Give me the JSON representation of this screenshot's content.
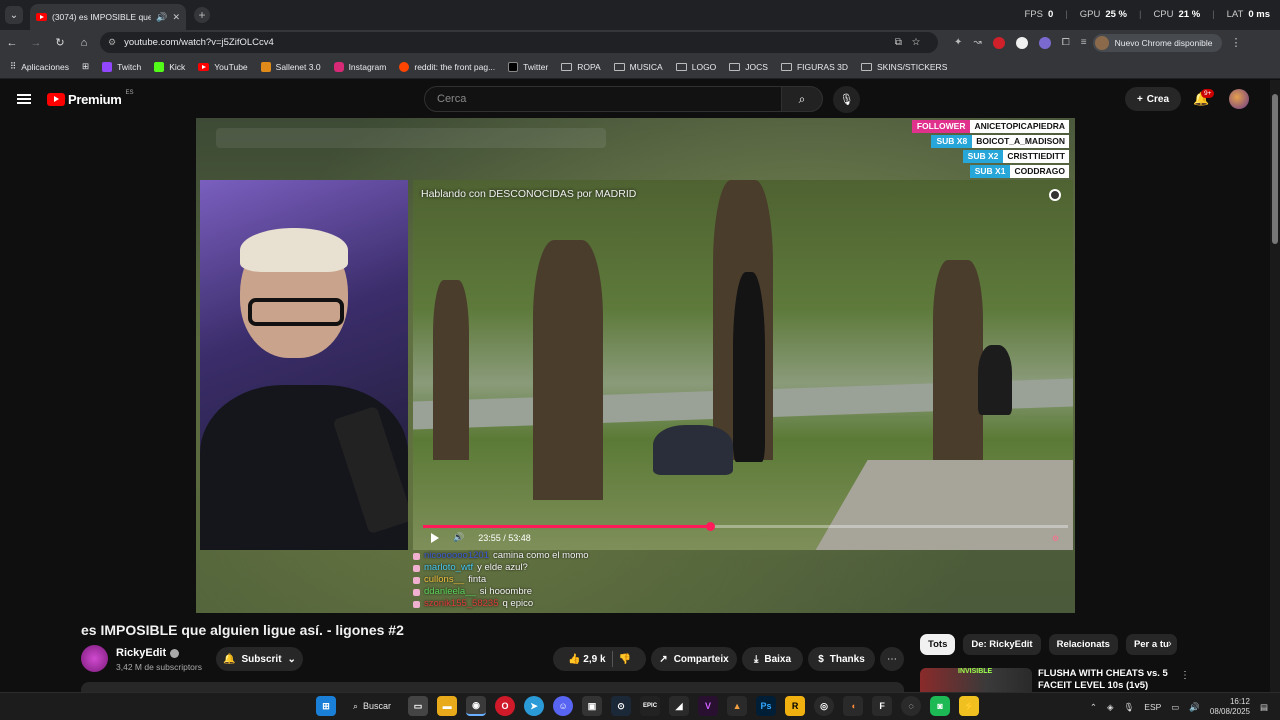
{
  "browser": {
    "tab_title": "(3074) es IMPOSIBLE que a",
    "url": "youtube.com/watch?v=j5ZifOLCcv4",
    "chrome_update_label": "Nuevo Chrome disponible",
    "perf": [
      {
        "label": "FPS",
        "value": "0"
      },
      {
        "label": "GPU",
        "value": "25 %"
      },
      {
        "label": "CPU",
        "value": "21 %"
      },
      {
        "label": "LAT",
        "value": "0 ms"
      }
    ]
  },
  "bookmarks": [
    "Aplicaciones",
    "Twitch",
    "Kick",
    "YouTube",
    "Sallenet 3.0",
    "Instagram",
    "reddit: the front pag...",
    "Twitter",
    "ROPA",
    "MUSICA",
    "LOGO",
    "JOCS",
    "FIGURAS 3D",
    "SKINS/STICKERS"
  ],
  "youtube_header": {
    "logo_text": "Premium",
    "logo_region": "ES",
    "search_placeholder": "Cerca",
    "create_label": "Crea",
    "notifications_badge": "9+"
  },
  "video": {
    "scene_title": "Hablando con DESCONOCIDAS por MADRID",
    "time": "23:55 / 53:48",
    "progress": 0.445,
    "alerts": [
      {
        "tag": "FOLLOWER",
        "name": "ANICETOPICAPIEDRA",
        "color": "#e0328c"
      },
      {
        "tag": "SUB X8",
        "name": "BOICOT_A_MADISON",
        "color": "#27a6d9"
      },
      {
        "tag": "SUB X2",
        "name": "CRISTTIEDITT",
        "color": "#27a6d9"
      },
      {
        "tag": "SUB X1",
        "name": "CODDRAGO",
        "color": "#27a6d9"
      }
    ],
    "chat": [
      {
        "user": "nicoooooo1201",
        "msg": "camina como el momo",
        "color": "#3b5bd6"
      },
      {
        "user": "marloto_wtf",
        "msg": "y elde azul?",
        "color": "#45c8f0"
      },
      {
        "user": "cullons__",
        "msg": "finta",
        "color": "#f0c040"
      },
      {
        "user": "ddanleela__",
        "msg": "si hooombre",
        "color": "#5cd65c"
      },
      {
        "user": "szonik155_58235",
        "msg": "q epico",
        "color": "#e03c3c"
      }
    ]
  },
  "watch": {
    "title": "es IMPOSIBLE que alguien ligue así. - ligones #2",
    "channel": "RickyEdit",
    "subscribers": "3,42 M de subscriptors",
    "subscribe_label": "Subscrit",
    "likes": "2,9 k",
    "share_label": "Comparteix",
    "download_label": "Baixa",
    "thanks_label": "Thanks"
  },
  "related": {
    "chips": [
      "Tots",
      "De: RickyEdit",
      "Relacionats",
      "Per a tu"
    ],
    "first_video_title": "FLUSHA WITH CHEATS vs. 5 FACEIT LEVEL 10s (1v5)",
    "first_video_thumb_label": "INVISIBLE"
  },
  "taskbar": {
    "search_label": "Buscar",
    "language": "ESP",
    "time": "16:12",
    "date": "08/08/2025"
  }
}
